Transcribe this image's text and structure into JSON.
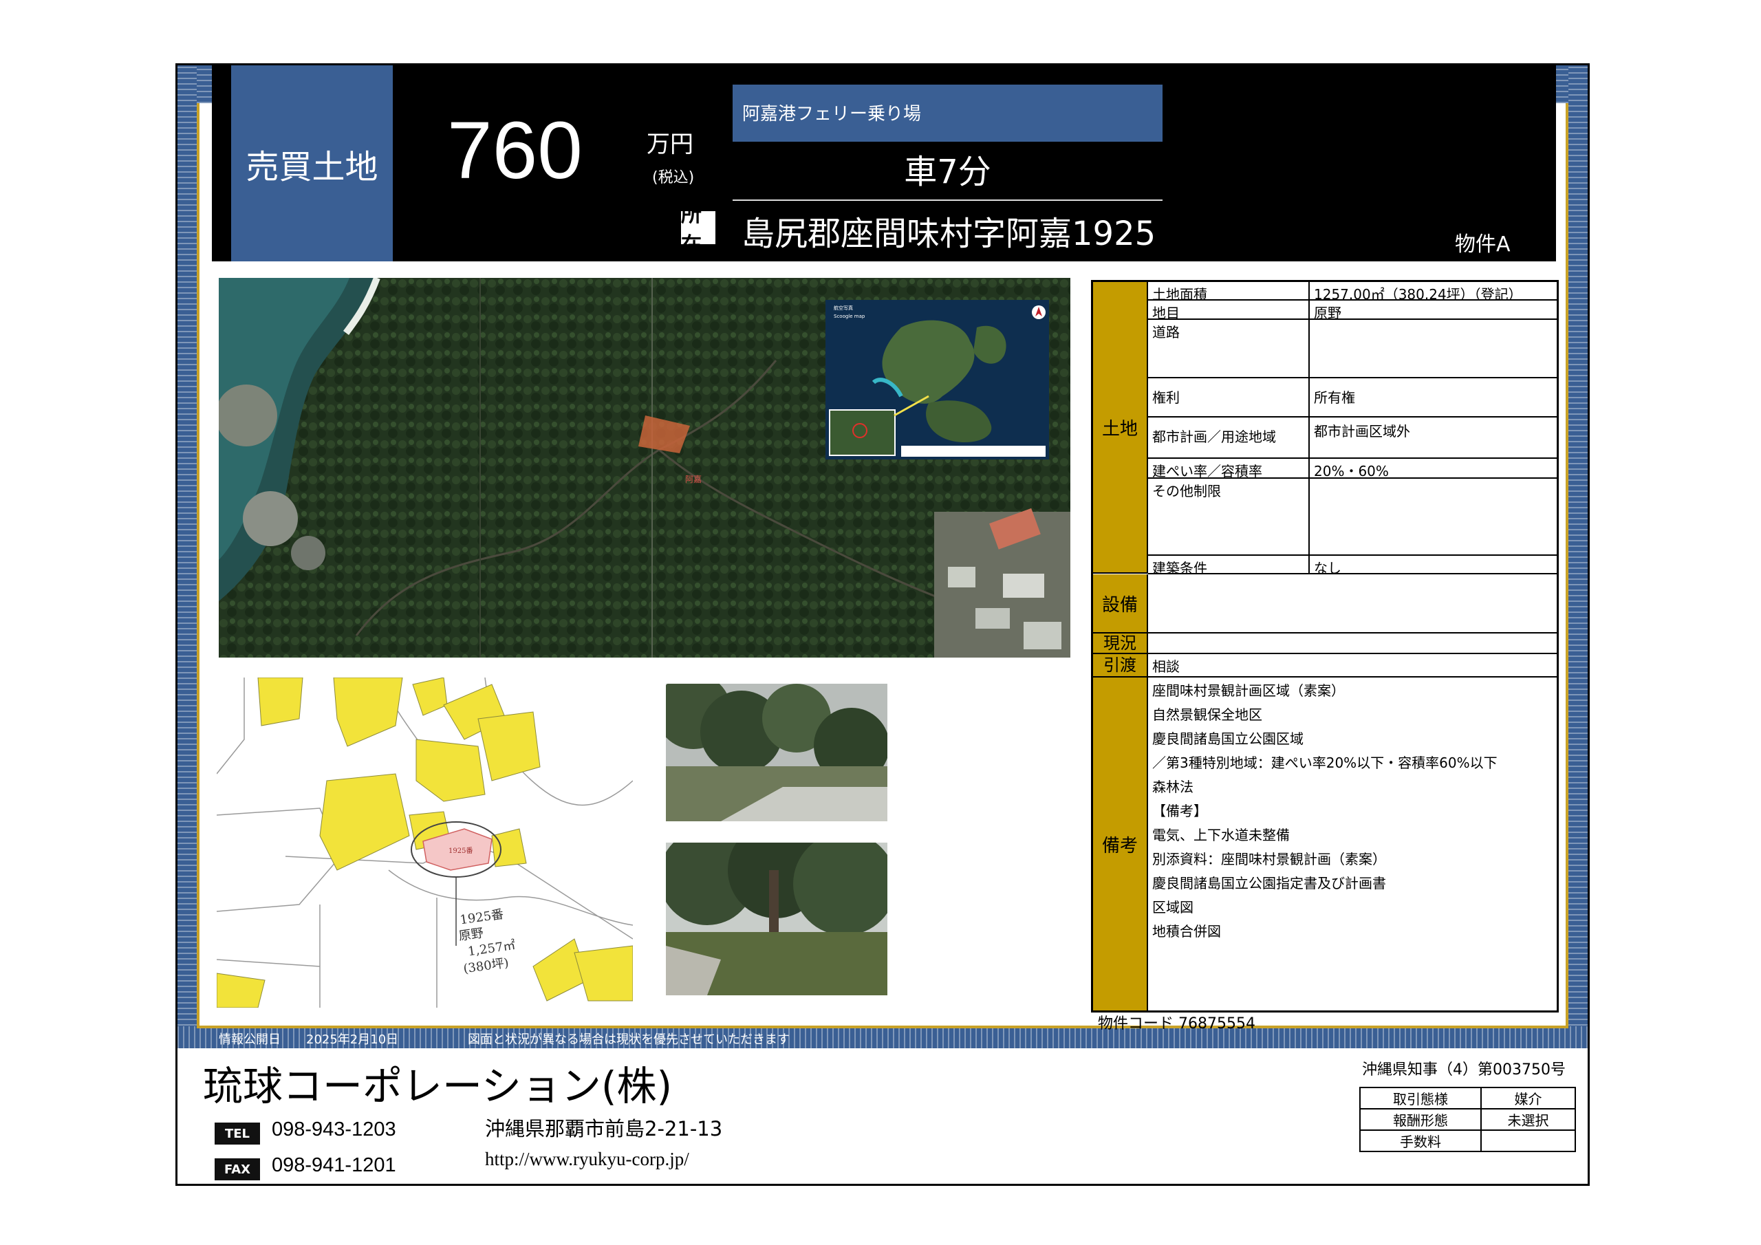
{
  "header": {
    "listing_type": "売買土地",
    "price": "760",
    "price_unit": "万円",
    "price_tax": "(税込)",
    "nearest_station": "阿嘉港フェリー乗り場",
    "travel_time": "車7分",
    "address_icon_label": "所在",
    "address": "島尻郡座間味村字阿嘉1925",
    "property_name": "物件A"
  },
  "map_labels": {
    "aerial_marker": "阿嘉",
    "inset_title": "航空写真",
    "inset_subtitle": "Scoogle map",
    "survey_lot": "1925番",
    "survey_note_line1": "1925番",
    "survey_note_line2": "原野",
    "survey_note_line3": "1,257㎡",
    "survey_note_line4": "(380坪)"
  },
  "spec": {
    "land": {
      "category": "土地",
      "rows": [
        {
          "label": "土地面積",
          "value": "1257.00㎡（380.24坪）（登記）"
        },
        {
          "label": "地目",
          "value": "原野"
        },
        {
          "label": "道路",
          "value": ""
        },
        {
          "label": "権利",
          "value": "所有権"
        },
        {
          "label": "都市計画／用途地域",
          "value": "都市計画区域外"
        },
        {
          "label": "建ぺい率／容積率",
          "value": "20%・60%"
        },
        {
          "label": "その他制限",
          "value": ""
        },
        {
          "label": "建築条件",
          "value": "なし"
        }
      ]
    },
    "facilities": {
      "category": "設備",
      "value": ""
    },
    "status": {
      "category": "現況",
      "value": ""
    },
    "handover": {
      "category": "引渡",
      "value": "相談"
    },
    "notes": {
      "category": "備考",
      "lines": [
        "座間味村景観計画区域（素案）",
        "自然景観保全地区",
        "慶良間諸島国立公園区域",
        "／第3種特別地域：建ぺい率20%以下・容積率60%以下",
        "森林法",
        "【備考】",
        "電気、上下水道未整備",
        "別添資料：座間味村景観計画（素案）",
        "慶良間諸島国立公園指定書及び計画書",
        "区域図",
        "地積合併図"
      ]
    }
  },
  "property_code_label": "物件コード",
  "property_code": "76875554",
  "meta": {
    "published_label": "情報公開日",
    "published_date": "2025年2月10日",
    "disclaimer": "図面と状況が異なる場合は現状を優先させていただきます"
  },
  "company": {
    "name": "琉球コーポレーション(株)",
    "tel_label": "TEL",
    "tel": "098-943-1203",
    "fax_label": "FAX",
    "fax": "098-941-1201",
    "address": "沖縄県那覇市前島2-21-13",
    "website": "http://www.ryukyu-corp.jp/",
    "license": "沖縄県知事（4）第003750号"
  },
  "deal": {
    "rows": [
      {
        "label": "取引態様",
        "value": "媒介"
      },
      {
        "label": "報酬形態",
        "value": "未選択"
      },
      {
        "label": "手数料",
        "value": ""
      }
    ]
  },
  "colors": {
    "navy": "#3a5f94",
    "gold": "#c49c00",
    "frame_gold": "#c9a227",
    "survey_yellow": "#f2e33a"
  }
}
